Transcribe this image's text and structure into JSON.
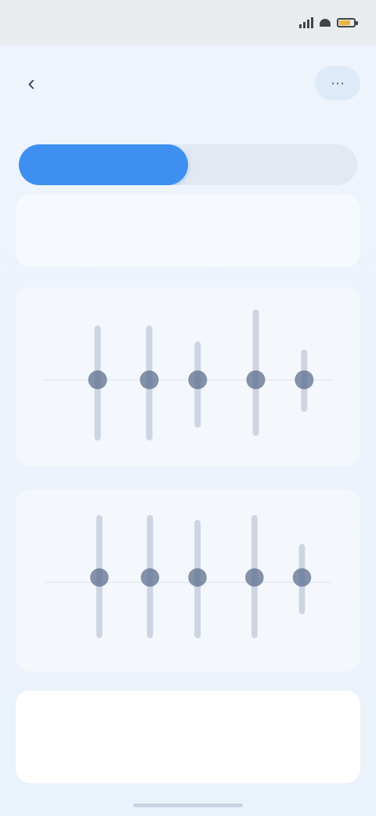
{
  "status_bar": {
    "time": "",
    "battery_level": 0.8
  },
  "header": {
    "title": "",
    "back_icon": "chevron-left-icon",
    "action_icon": "more-icon"
  },
  "tabs": [
    {
      "label": "",
      "active": true
    },
    {
      "label": "",
      "active": false
    }
  ],
  "info": {
    "label": "",
    "value": ""
  },
  "charts": {
    "chart1": {
      "points": [
        {
          "x": 0.22,
          "y": 0.52,
          "range": [
            0.2,
            0.88
          ]
        },
        {
          "x": 0.38,
          "y": 0.52,
          "range": [
            0.2,
            0.88
          ]
        },
        {
          "x": 0.53,
          "y": 0.52,
          "range": [
            0.3,
            0.8
          ]
        },
        {
          "x": 0.71,
          "y": 0.52,
          "range": [
            0.1,
            0.85
          ]
        },
        {
          "x": 0.86,
          "y": 0.52,
          "range": [
            0.35,
            0.7
          ]
        }
      ]
    },
    "chart2": {
      "points": [
        {
          "x": 0.22,
          "y": 0.49,
          "range": [
            0.12,
            0.85
          ]
        },
        {
          "x": 0.38,
          "y": 0.49,
          "range": [
            0.12,
            0.85
          ]
        },
        {
          "x": 0.53,
          "y": 0.49,
          "range": [
            0.15,
            0.85
          ]
        },
        {
          "x": 0.71,
          "y": 0.49,
          "range": [
            0.12,
            0.85
          ]
        },
        {
          "x": 0.86,
          "y": 0.49,
          "range": [
            0.3,
            0.7
          ]
        }
      ]
    }
  },
  "bottom": {
    "label": "",
    "value": ""
  },
  "colors": {
    "accent": "#3f8ff0",
    "point": "#5e6f8e",
    "range": "#aebbd0"
  }
}
